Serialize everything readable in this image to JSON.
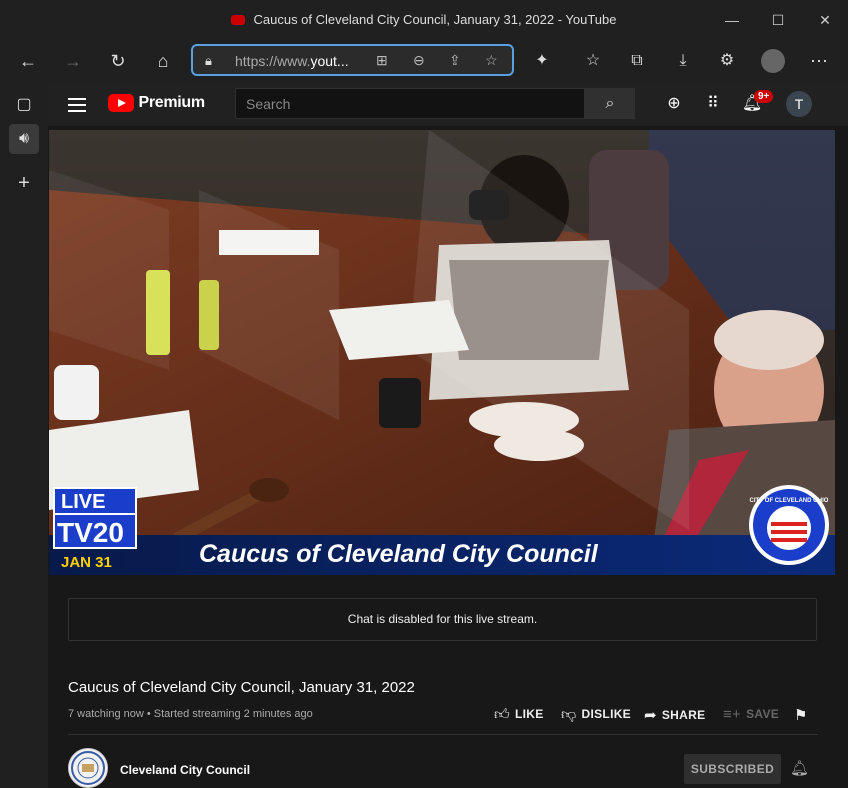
{
  "window": {
    "title": "Caucus of Cleveland City Council, January 31, 2022 - YouTube",
    "controls": [
      "—",
      "☐",
      "✕"
    ]
  },
  "browser": {
    "url_prefix": "https://www.",
    "url_main": "yout...",
    "nav": {
      "back": "←",
      "forward": "→",
      "reload": "↻",
      "home": "⌂"
    },
    "more": "⋯"
  },
  "youtube": {
    "brand": "Premium",
    "search_placeholder": "Search",
    "notif_count": "9+",
    "user_initial": "T"
  },
  "video": {
    "overlay_title": "Caucus of Cleveland City Council",
    "live_label": "LIVE",
    "channel_label": "TV20",
    "date_label": "JAN 31",
    "seal_text": "CITY OF CLEVELAND OHIO"
  },
  "chat": {
    "disabled_text": "Chat is disabled for this live stream."
  },
  "info": {
    "title": "Caucus of Cleveland City Council, January 31, 2022",
    "meta": "7 watching now • Started streaming 2 minutes ago",
    "like": "LIKE",
    "dislike": "DISLIKE",
    "share": "SHARE",
    "save": "SAVE"
  },
  "channel": {
    "name": "Cleveland City Council",
    "subscribe_label": "SUBSCRIBED"
  },
  "colors": {
    "accent_blue": "#5aa0e0",
    "youtube_red": "#ff0000",
    "badge_red": "#cc0000"
  }
}
